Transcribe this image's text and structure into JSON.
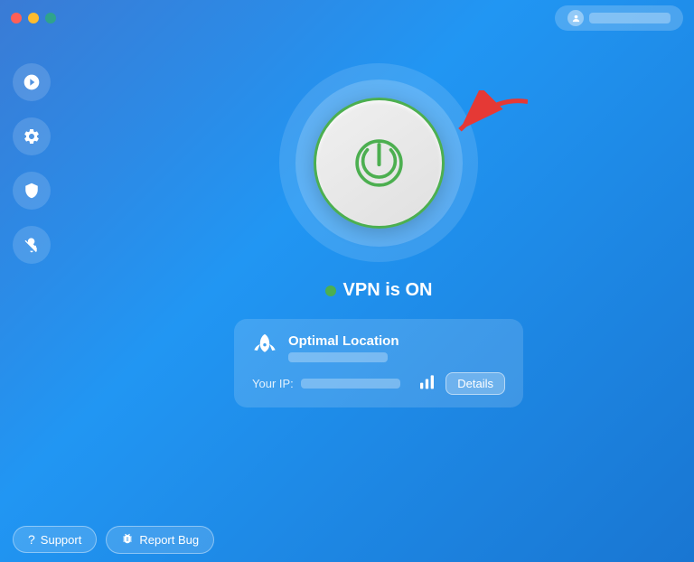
{
  "titlebar": {
    "traffic_lights": [
      "close",
      "minimize",
      "maximize"
    ],
    "user_button_label": "username"
  },
  "sidebar": {
    "items": [
      {
        "id": "rocket",
        "icon": "🚀",
        "label": "Quick Connect"
      },
      {
        "id": "settings",
        "icon": "⚙️",
        "label": "Settings"
      },
      {
        "id": "lock",
        "icon": "🔒",
        "label": "Security"
      },
      {
        "id": "hand",
        "icon": "✋",
        "label": "Block"
      }
    ]
  },
  "main": {
    "vpn_status": "VPN is ON",
    "vpn_active": true,
    "location": {
      "name": "Optimal Location",
      "subtitle_blurred": true
    },
    "ip_label": "Your IP:",
    "ip_blurred": true
  },
  "bottom": {
    "support_label": "Support",
    "report_bug_label": "Report Bug"
  }
}
